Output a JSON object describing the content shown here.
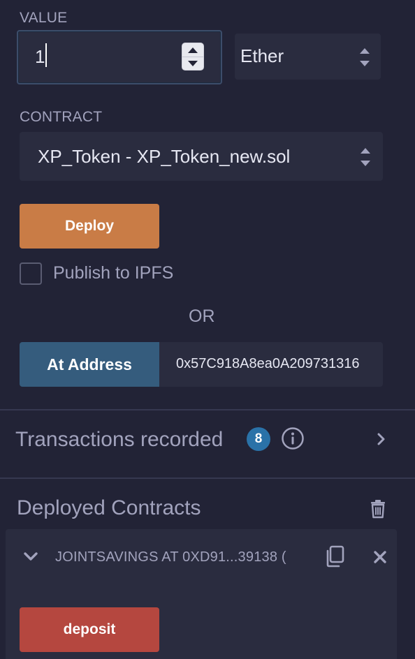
{
  "value": {
    "label": "VALUE",
    "amount": "1",
    "unit": "Ether"
  },
  "contract": {
    "label": "CONTRACT",
    "selected": "XP_Token - XP_Token_new.sol"
  },
  "deploy": {
    "button_label": "Deploy",
    "publish_label": "Publish to IPFS",
    "or_label": "OR"
  },
  "at_address": {
    "button_label": "At Address",
    "address_value": "0x57C918A8ea0A209731316"
  },
  "transactions": {
    "title": "Transactions recorded",
    "count": "8"
  },
  "deployed": {
    "title": "Deployed Contracts",
    "instance_label": "JOINTSAVINGS AT 0XD91...39138 (",
    "deposit_label": "deposit"
  },
  "colors": {
    "background": "#222336",
    "deploy_button": "#c97c46",
    "at_address_button": "#355c7d",
    "deposit_button": "#b5473f",
    "badge": "#2a72a8"
  }
}
